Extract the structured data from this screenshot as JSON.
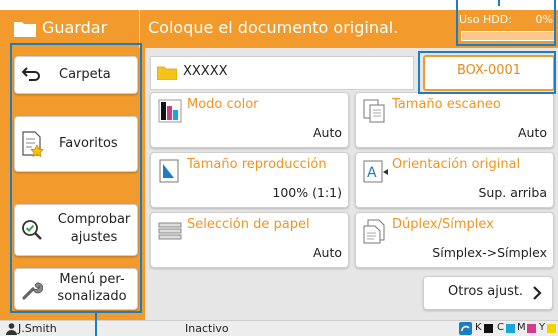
{
  "header": {
    "title": "Guardar",
    "message": "Coloque el documento original.",
    "hdd_label": "Uso HDD:",
    "hdd_percent": "0%",
    "hdd_usage_fraction": 0.0
  },
  "sidebar": {
    "items": [
      {
        "label": "Carpeta",
        "icon": "back-arrow-icon"
      },
      {
        "label": "Favoritos",
        "icon": "favorites-star-icon"
      },
      {
        "label_line1": "Comprobar",
        "label_line2": "ajustes",
        "icon": "magnifier-check-icon"
      },
      {
        "label_line1": "Menú per-",
        "label_line2": "sonalizado",
        "icon": "wrench-icon"
      }
    ]
  },
  "main": {
    "path": "XXXXX",
    "box_button": "BOX-0001",
    "tiles": [
      {
        "name": "Modo color",
        "value": "Auto",
        "icon": "color-mode-icon"
      },
      {
        "name": "Tamaño escaneo",
        "value": "Auto",
        "icon": "scan-size-icon"
      },
      {
        "name": "Tamaño reproducción",
        "value": "100% (1:1)",
        "icon": "reproduction-size-icon"
      },
      {
        "name": "Orientación original",
        "value": "Sup. arriba",
        "icon": "orientation-icon"
      },
      {
        "name": "Selección de papel",
        "value": "Auto",
        "icon": "paper-tray-icon"
      },
      {
        "name": "Dúplex/Símplex",
        "value": "Símplex->Símplex",
        "icon": "duplex-icon"
      }
    ],
    "more_button": "Otros ajust."
  },
  "status": {
    "user": "J.Smith",
    "state": "Inactivo",
    "inks": [
      "K",
      "C",
      "M",
      "Y"
    ]
  },
  "colors": {
    "accent": "#f39a2c",
    "highlight": "#1a7ec6",
    "ink_k": "#111111",
    "ink_c": "#19a6d9",
    "ink_m": "#d23a8e",
    "ink_y": "#f2d400"
  }
}
